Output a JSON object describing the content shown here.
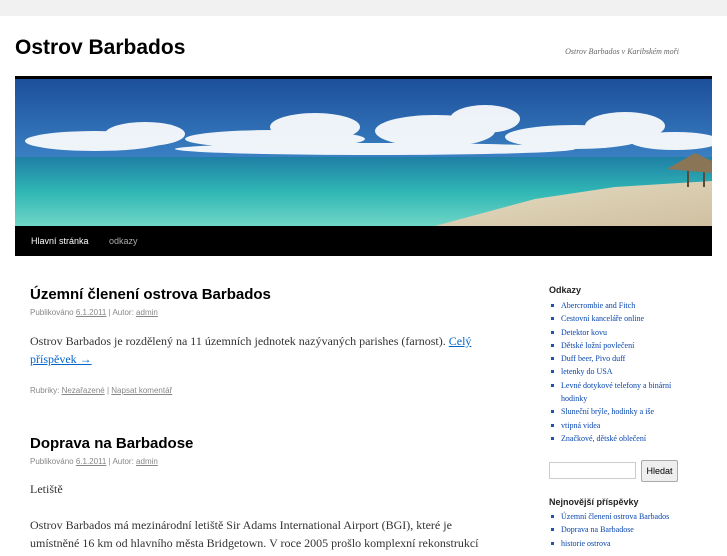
{
  "site": {
    "title": "Ostrov Barbados",
    "description": "Ostrov Barbados v Karibském moři"
  },
  "nav": {
    "items": [
      "Hlavní stránka",
      "odkazy"
    ]
  },
  "posts": [
    {
      "title": "Územní členení ostrova Barbados",
      "meta_prefix": "Publikováno",
      "date": "6.1.2011",
      "author_prefix": "| Autor:",
      "author": "admin",
      "text": "Ostrov Barbados je rozdělený na 11 územních jednotek nazývaných parishes (farnost).",
      "more": "Celý příspěvek →",
      "categories_prefix": "Rubriky:",
      "category": "Nezařazené",
      "separator": "|",
      "comment": "Napsat komentář"
    },
    {
      "title": "Doprava na Barbadose",
      "meta_prefix": "Publikováno",
      "date": "6.1.2011",
      "author_prefix": "| Autor:",
      "author": "admin",
      "heading_text": "Letiště",
      "text": "Ostrov Barbados má mezinárodní letiště Sir Adams International Airport (BGI), které je umístněné 16 km od hlavního města Bridgetown. V roce 2005 prošlo komplexní rekonstrukcí"
    }
  ],
  "sidebar": {
    "links_title": "Odkazy",
    "links": [
      "Abercrombie and Fitch",
      "Cestovní kanceláře online",
      "Detektor kovu",
      "Dětské ložní povlečení",
      "Duff beer, Pivo duff",
      "letenky do USA",
      "Levné dotykové telefony a binární hodinky",
      "Sluneční brýle, hodinky a iše",
      "vtipná videa",
      "Značkové, dětské oblečení"
    ],
    "search_button": "Hledat",
    "recent_title": "Nejnovější příspěvky",
    "recent": [
      "Územní členení ostrova Barbados",
      "Doprava na Barbadose",
      "historie ostrova"
    ]
  }
}
